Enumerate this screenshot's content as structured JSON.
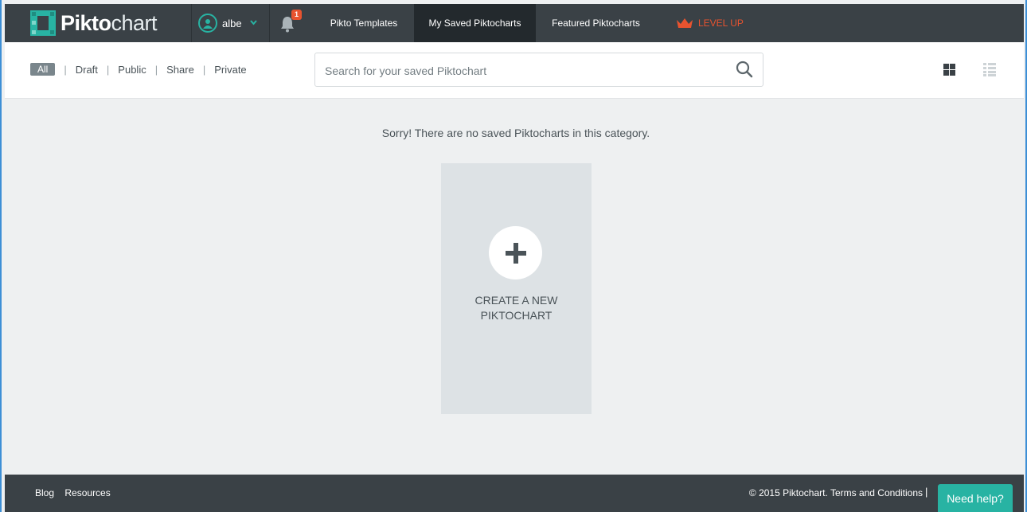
{
  "topbar": {
    "logo_bold": "Pikto",
    "logo_light": "chart",
    "username": "albe",
    "notification_count": "1",
    "nav": [
      {
        "label": "Pikto Templates"
      },
      {
        "label": "My Saved Piktocharts"
      },
      {
        "label": "Featured Piktocharts"
      }
    ],
    "level_up_label": "LEVEL UP"
  },
  "filters": {
    "items": [
      "All",
      "Draft",
      "Public",
      "Share",
      "Private"
    ],
    "active": "All"
  },
  "search": {
    "placeholder": "Search for your saved Piktochart",
    "value": ""
  },
  "main": {
    "empty_message": "Sorry! There are no saved Piktocharts in this category.",
    "create_line1": "CREATE A NEW",
    "create_line2": "PIKTOCHART"
  },
  "footer": {
    "links": [
      "Blog",
      "Resources"
    ],
    "copyright": "© 2015 Piktochart.",
    "terms": "Terms and Conditions",
    "help_label": "Need help?"
  },
  "colors": {
    "topbar": "#3a4146",
    "accent_teal": "#28b3a3",
    "level_up": "#e8532f",
    "background": "#eef0f1",
    "card": "#dde2e5"
  },
  "icons": [
    "logo-mark-icon",
    "user-icon",
    "chevron-down-icon",
    "bell-icon",
    "crown-icon",
    "search-icon",
    "grid-view-icon",
    "list-view-icon",
    "plus-icon"
  ]
}
